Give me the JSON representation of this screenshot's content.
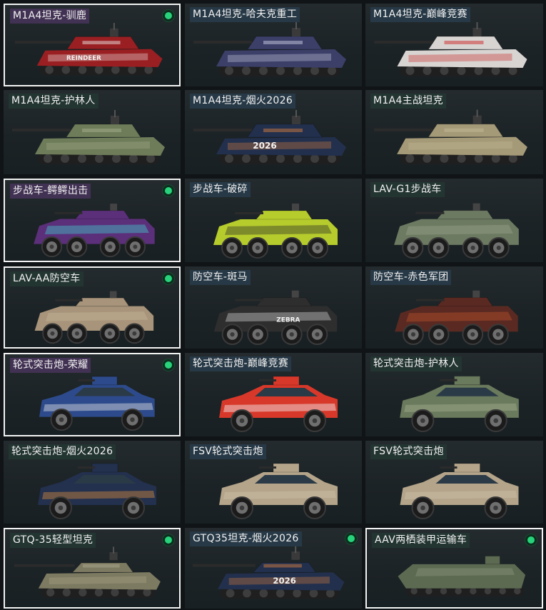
{
  "cards": [
    {
      "name": "M1A4坦克-驯鹿",
      "type": "tank",
      "selected": true,
      "badge": true,
      "tag": "purple",
      "body": "#9a1f22",
      "accent": "#e9e3df",
      "decal": "REINDEER"
    },
    {
      "name": "M1A4坦克-哈夫克重工",
      "type": "tank",
      "selected": false,
      "badge": false,
      "tag": "blue",
      "body": "#3c3f68",
      "accent": "#c9cbe0",
      "decal": ""
    },
    {
      "name": "M1A4坦克-巅峰竞赛",
      "type": "tank",
      "selected": false,
      "badge": false,
      "tag": "blue",
      "body": "#d8d4d2",
      "accent": "#c92828",
      "decal": ""
    },
    {
      "name": "M1A4坦克-护林人",
      "type": "tank",
      "selected": false,
      "badge": false,
      "tag": "green",
      "body": "#6e7c5a",
      "accent": "#a6ad8c",
      "decal": ""
    },
    {
      "name": "M1A4坦克-烟火2026",
      "type": "tank",
      "selected": false,
      "badge": false,
      "tag": "blue",
      "body": "#22304e",
      "accent": "#d07a3c",
      "decal": "2026"
    },
    {
      "name": "M1A4主战坦克",
      "type": "tank",
      "selected": false,
      "badge": false,
      "tag": "green",
      "body": "#a59a78",
      "accent": "#c4b996",
      "decal": ""
    },
    {
      "name": "步战车-鳄鳄出击",
      "type": "ifv",
      "selected": true,
      "badge": true,
      "tag": "purple",
      "body": "#5b2f7a",
      "accent": "#3fd4d0",
      "decal": ""
    },
    {
      "name": "步战车-破碎",
      "type": "ifv",
      "selected": false,
      "badge": false,
      "tag": "blue",
      "body": "#b6cc2c",
      "accent": "#2a2a2a",
      "decal": ""
    },
    {
      "name": "LAV-G1步战车",
      "type": "ifv",
      "selected": false,
      "badge": false,
      "tag": "green",
      "body": "#6d7a62",
      "accent": "#9aa48c",
      "decal": ""
    },
    {
      "name": "LAV-AA防空车",
      "type": "ifv",
      "selected": true,
      "badge": true,
      "tag": "green",
      "body": "#a8947a",
      "accent": "#c7b89e",
      "decal": ""
    },
    {
      "name": "防空车-斑马",
      "type": "ifv",
      "selected": false,
      "badge": false,
      "tag": "blue",
      "body": "#2e2e2e",
      "accent": "#d8d8d8",
      "decal": "ZEBRA"
    },
    {
      "name": "防空车-赤色军团",
      "type": "ifv",
      "selected": false,
      "badge": false,
      "tag": "blue",
      "body": "#5a2a22",
      "accent": "#c2552e",
      "decal": ""
    },
    {
      "name": "轮式突击炮-荣耀",
      "type": "apc",
      "selected": true,
      "badge": true,
      "tag": "purple",
      "body": "#2d4b8c",
      "accent": "#e0e0e0",
      "decal": ""
    },
    {
      "name": "轮式突击炮-巅峰竞赛",
      "type": "apc",
      "selected": false,
      "badge": false,
      "tag": "blue",
      "body": "#d8382a",
      "accent": "#f1f1f1",
      "decal": ""
    },
    {
      "name": "轮式突击炮-护林人",
      "type": "apc",
      "selected": false,
      "badge": false,
      "tag": "green",
      "body": "#6a7a5c",
      "accent": "#a3ad91",
      "decal": ""
    },
    {
      "name": "轮式突击炮-烟火2026",
      "type": "apc",
      "selected": false,
      "badge": false,
      "tag": "green",
      "body": "#23304e",
      "accent": "#d08a3e",
      "decal": ""
    },
    {
      "name": "FSV轮式突击炮",
      "type": "apc",
      "selected": false,
      "badge": false,
      "tag": "blue",
      "body": "#b3a48a",
      "accent": "#cfc2a8",
      "decal": ""
    },
    {
      "name": "FSV轮式突击炮",
      "type": "apc",
      "selected": false,
      "badge": false,
      "tag": "green",
      "body": "#b3a48a",
      "accent": "#cfc2a8",
      "decal": ""
    },
    {
      "name": "GTQ-35轻型坦克",
      "type": "light",
      "selected": true,
      "badge": true,
      "tag": "green",
      "body": "#7d7a62",
      "accent": "#a8a68a",
      "decal": ""
    },
    {
      "name": "GTQ35坦克-烟火2026",
      "type": "light",
      "selected": false,
      "badge": true,
      "tag": "blue",
      "body": "#22304e",
      "accent": "#d07a3c",
      "decal": "2026"
    },
    {
      "name": "AAV两栖装甲运输车",
      "type": "aav",
      "selected": true,
      "badge": true,
      "tag": "green",
      "body": "#5d6a52",
      "accent": "#8f9a80",
      "decal": ""
    }
  ]
}
